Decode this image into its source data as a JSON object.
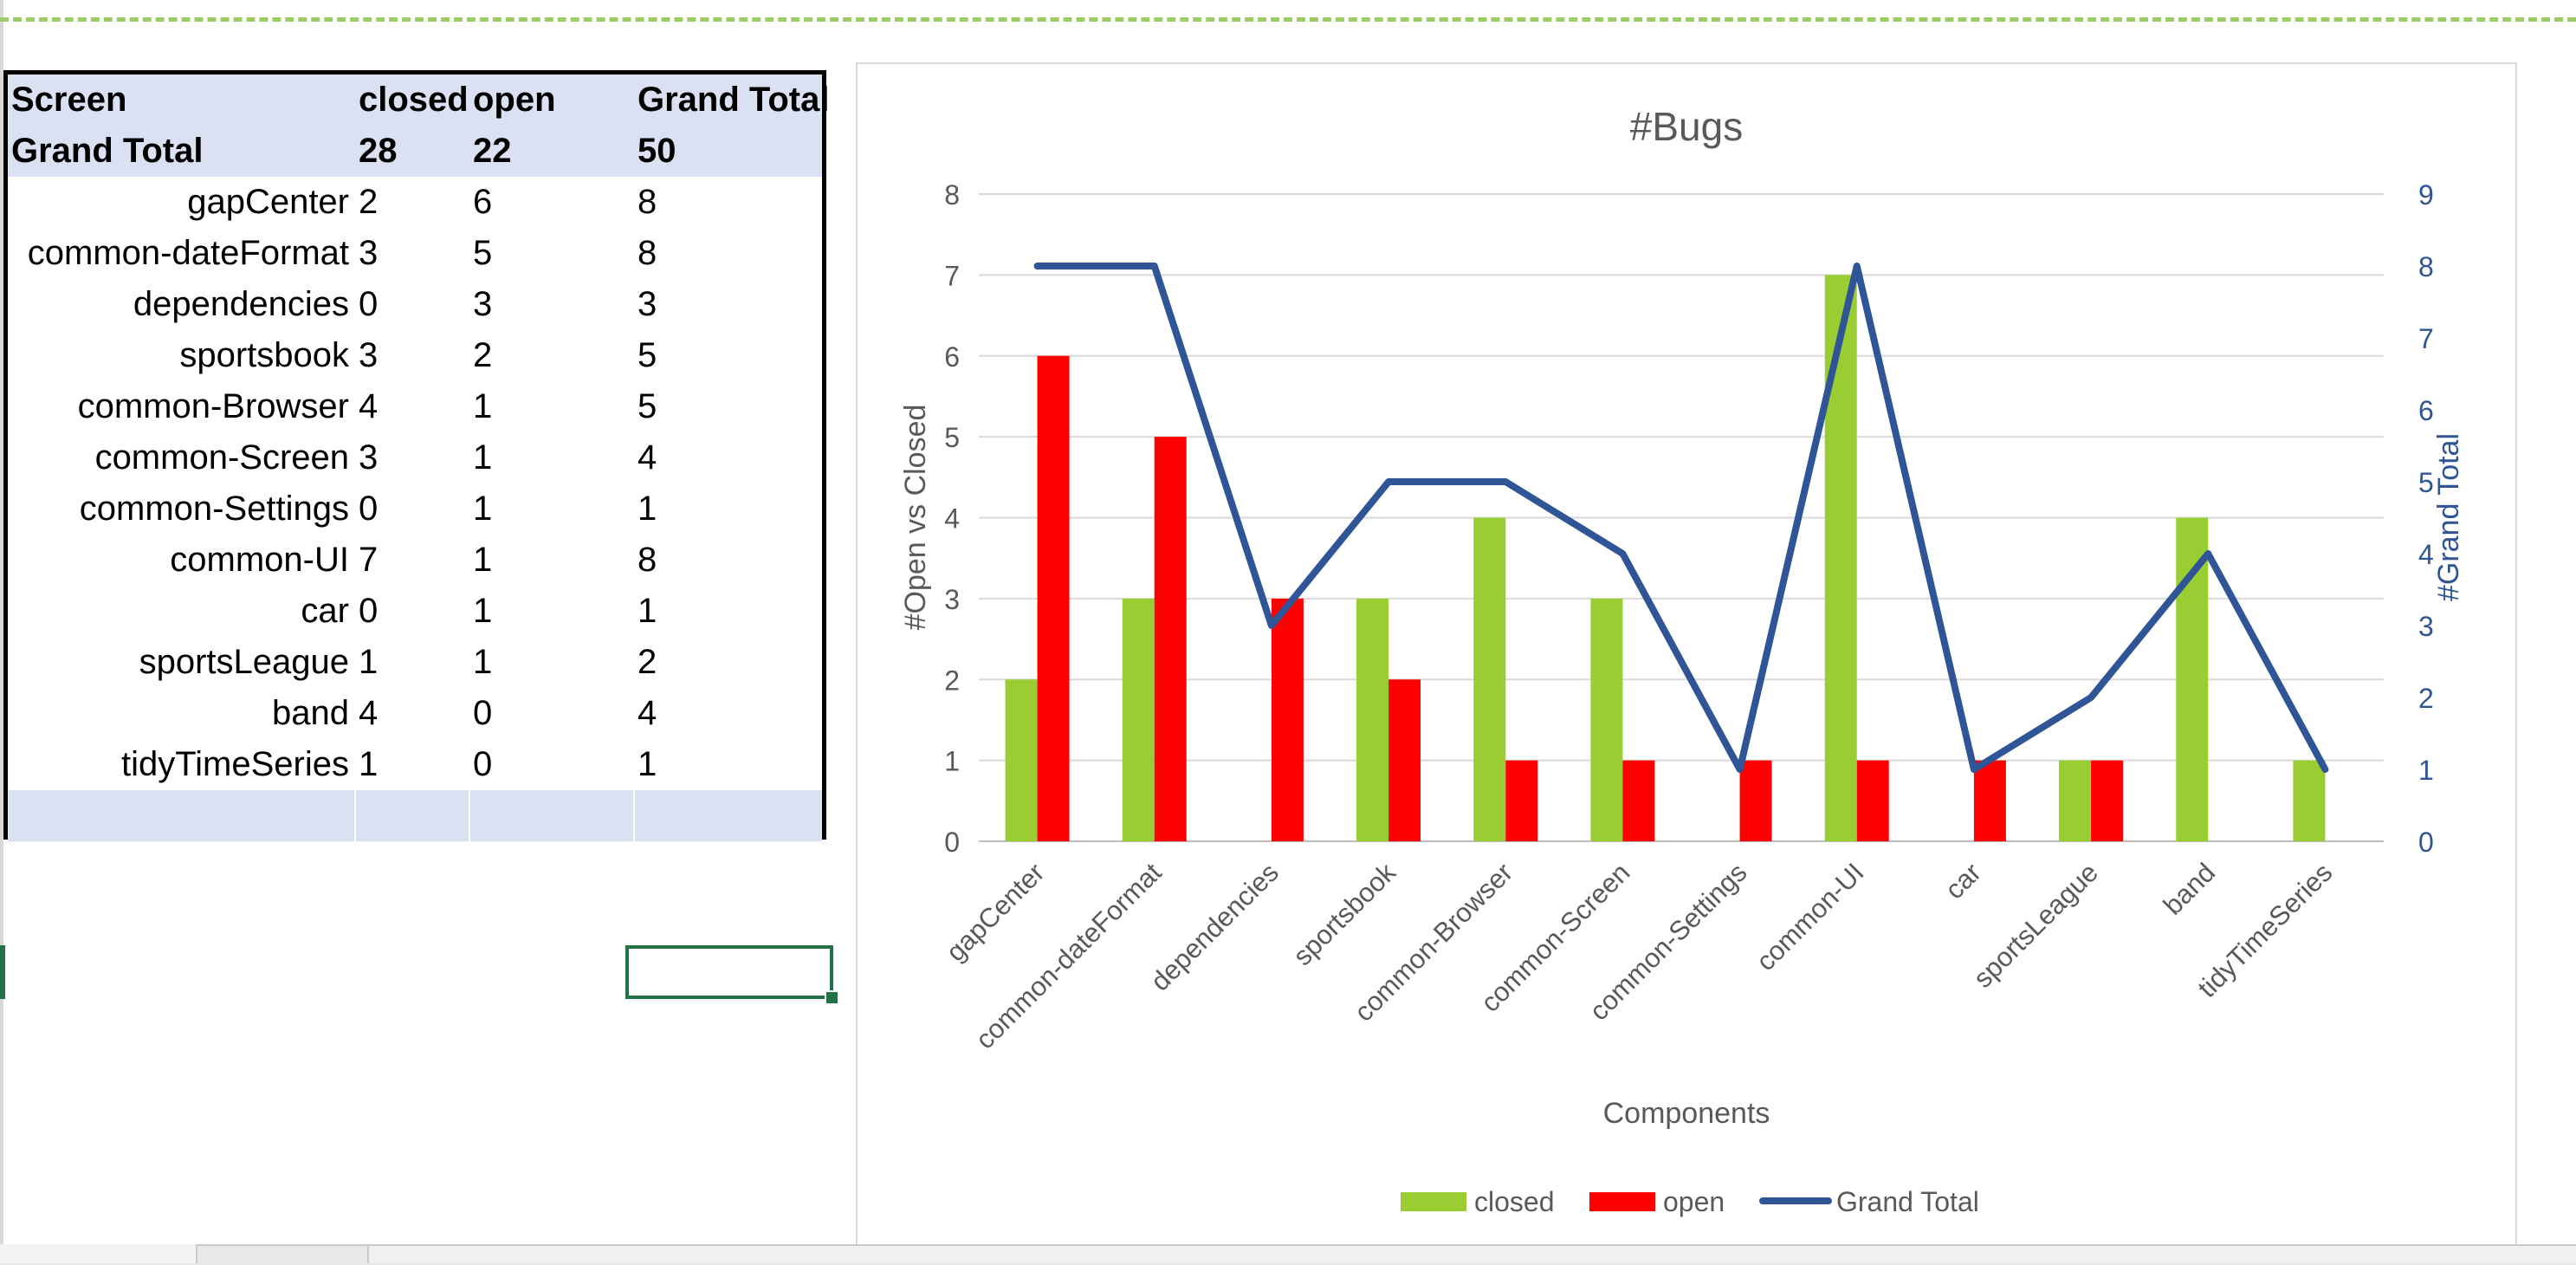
{
  "pivot": {
    "headers": [
      "Screen",
      "closed",
      "open",
      "Grand Total"
    ],
    "total": [
      "Grand Total",
      "28",
      "22",
      "50"
    ],
    "rows": [
      [
        "gapCenter",
        "2",
        "6",
        "8"
      ],
      [
        "common-dateFormat",
        "3",
        "5",
        "8"
      ],
      [
        "dependencies",
        "0",
        "3",
        "3"
      ],
      [
        "sportsbook",
        "3",
        "2",
        "5"
      ],
      [
        "common-Browser",
        "4",
        "1",
        "5"
      ],
      [
        "common-Screen",
        "3",
        "1",
        "4"
      ],
      [
        "common-Settings",
        "0",
        "1",
        "1"
      ],
      [
        "common-UI",
        "7",
        "1",
        "8"
      ],
      [
        "car",
        "0",
        "1",
        "1"
      ],
      [
        "sportsLeague",
        "1",
        "1",
        "2"
      ],
      [
        "band",
        "4",
        "0",
        "4"
      ],
      [
        "tidyTimeSeries",
        "1",
        "0",
        "1"
      ]
    ]
  },
  "chart_data": {
    "type": "bar",
    "title": "#Bugs",
    "xlabel": "Components",
    "ylabel": "#Open vs Closed",
    "y2label": "#Grand Total",
    "ylim": [
      0,
      8
    ],
    "y2lim": [
      0,
      9
    ],
    "categories": [
      "gapCenter",
      "common-dateFormat",
      "dependencies",
      "sportsbook",
      "common-Browser",
      "common-Screen",
      "common-Settings",
      "common-UI",
      "car",
      "sportsLeague",
      "band",
      "tidyTimeSeries"
    ],
    "series": [
      {
        "name": "closed",
        "type": "bar",
        "axis": "left",
        "color": "#9acd32",
        "values": [
          2,
          3,
          0,
          3,
          4,
          3,
          0,
          7,
          0,
          1,
          4,
          1
        ]
      },
      {
        "name": "open",
        "type": "bar",
        "axis": "left",
        "color": "#ff0000",
        "values": [
          6,
          5,
          3,
          2,
          1,
          1,
          1,
          1,
          1,
          1,
          0,
          0
        ]
      },
      {
        "name": "Grand Total",
        "type": "line",
        "axis": "right",
        "color": "#2f5597",
        "values": [
          8,
          8,
          3,
          5,
          5,
          4,
          1,
          8,
          1,
          2,
          4,
          1
        ]
      }
    ],
    "grid": true,
    "legend": "bottom"
  }
}
